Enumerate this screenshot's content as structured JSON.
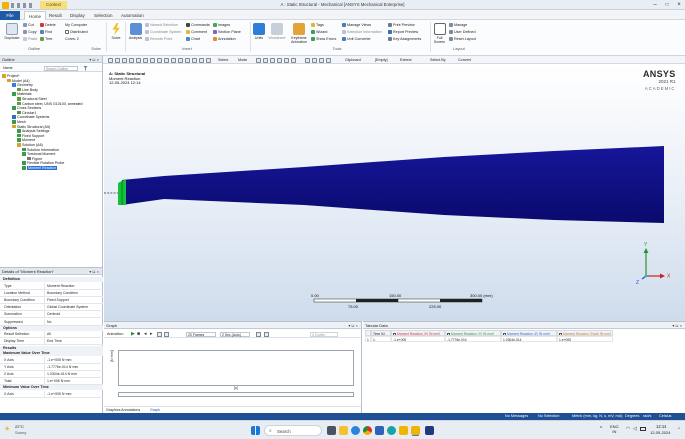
{
  "window": {
    "title": "A : Static Structural - Mechanical [ANSYS Mechanical Enterprise]",
    "context_tab": "Context"
  },
  "tabs": [
    "File",
    "Home",
    "Result",
    "Display",
    "Selection",
    "Automation"
  ],
  "search_placeholder": "Quick Search",
  "ribbon": {
    "outline": {
      "group": "Outline",
      "duplicate": "Duplicate",
      "cut": "Cut",
      "copy": "Copy",
      "paste": "Paste",
      "delete": "Delete",
      "find": "Find",
      "tree": "Tree",
      "my_computer": "My Computer",
      "distributed": "Distributed",
      "cores": "Cores: 2"
    },
    "solve": {
      "group": "Solve",
      "solve": "Solve"
    },
    "insert": {
      "group": "Insert",
      "analysis": "Analysis",
      "named_selection": "Named Selection",
      "coordinate_system": "Coordinate System",
      "remote_point": "Remote Point",
      "commands": "Commands",
      "comment": "Comment",
      "chart": "Chart",
      "images": "Images",
      "section_plane": "Section Plane",
      "annotation": "Annotation"
    },
    "tools": {
      "group": "Tools",
      "units": "Units",
      "worksheet": "Worksheet",
      "keyframe": "Keyframe Animation",
      "tags": "Tags",
      "wizard": "Wizard",
      "show_errors": "Show Errors",
      "manage_views": "Manage Views",
      "selection_info": "Selection Information",
      "unit_converter": "Unit Converter",
      "print_preview": "Print Preview",
      "report_preview": "Report Preview",
      "key_assignments": "Key Assignments"
    },
    "layout": {
      "group": "Layout",
      "full_screen": "Full Screen",
      "manage": "Manage",
      "user_defined": "User Defined",
      "reset_layout": "Reset Layout"
    }
  },
  "toolbar": {
    "select": "Select",
    "mode": "Mode",
    "clipboard": "Clipboard",
    "empty": "[Empty]",
    "extend": "Extend",
    "select_by": "Select By",
    "convert": "Convert"
  },
  "outline": {
    "title": "Outline",
    "name_label": "Name",
    "search_placeholder": "Search Outline",
    "items": [
      {
        "label": "Project*",
        "level": 0,
        "color": "#d9a12a"
      },
      {
        "label": "Model (A4)",
        "level": 1,
        "color": "#d9a12a"
      },
      {
        "label": "Geometry",
        "level": 2,
        "color": "#3a7bd5"
      },
      {
        "label": "Line Body",
        "level": 3,
        "color": "#5c9e3e"
      },
      {
        "label": "Materials",
        "level": 2,
        "color": "#3a9a4a"
      },
      {
        "label": "Structural Steel",
        "level": 3,
        "color": "#5c9e3e"
      },
      {
        "label": "Carbon steel, UNS G10100, annealed",
        "level": 3,
        "color": "#5c9e3e"
      },
      {
        "label": "Cross Sections",
        "level": 2,
        "color": "#3a9a4a"
      },
      {
        "label": "Circular1",
        "level": 3,
        "color": "#3a9a4a"
      },
      {
        "label": "Coordinate Systems",
        "level": 2,
        "color": "#2e6ebf"
      },
      {
        "label": "Mesh",
        "level": 2,
        "color": "#3a9a4a"
      },
      {
        "label": "Static Structural (A5)",
        "level": 2,
        "color": "#d9a12a"
      },
      {
        "label": "Analysis Settings",
        "level": 3,
        "color": "#3a9a4a"
      },
      {
        "label": "Fixed Support",
        "level": 3,
        "color": "#3a9a4a"
      },
      {
        "label": "Moment",
        "level": 3,
        "color": "#3a9a4a"
      },
      {
        "label": "Solution (A6)",
        "level": 3,
        "color": "#d9a12a"
      },
      {
        "label": "Solution Information",
        "level": 4,
        "color": "#3a9a4a"
      },
      {
        "label": "Torsional Moment",
        "level": 4,
        "color": "#3a9a4a"
      },
      {
        "label": "Figure",
        "level": 5,
        "color": "#777777"
      },
      {
        "label": "Flexible Rotation Probe",
        "level": 4,
        "color": "#3a9a4a"
      },
      {
        "label": "Moment Reaction",
        "level": 4,
        "color": "#3a9a4a",
        "selected": true
      }
    ]
  },
  "details": {
    "title": "Details of \"Moment Reaction\"",
    "sections": [
      {
        "name": "Definition",
        "rows": [
          [
            "Type",
            "Moment Reaction"
          ],
          [
            "Location Method",
            "Boundary Condition"
          ],
          [
            "Boundary Condition",
            "Fixed Support"
          ],
          [
            "Orientation",
            "Global Coordinate System"
          ],
          [
            "Summation",
            "Centroid"
          ],
          [
            "Suppressed",
            "No"
          ]
        ]
      },
      {
        "name": "Options",
        "rows": [
          [
            "Result Selection",
            "All"
          ],
          [
            "Display Time",
            "End Time"
          ]
        ]
      },
      {
        "name": "Results",
        "rows": []
      },
      {
        "name": "Maximum Value Over Time",
        "rows": [
          [
            "X Axis",
            "-1.e+005 N·mm"
          ],
          [
            "Y Axis",
            "-1.7776e-014 N·mm"
          ],
          [
            "Z Axis",
            "1.0304e-014 N·mm"
          ],
          [
            "Total",
            "1.e+005 N·mm"
          ]
        ]
      },
      {
        "name": "Minimum Value Over Time",
        "rows": [
          [
            "X Axis",
            "-1.e+005 N·mm"
          ]
        ]
      }
    ]
  },
  "viewport": {
    "title": "A: Static Structural",
    "subtitle": "Moment Reaction",
    "date": "12-05-2024 12:14",
    "logo": "ANSYS",
    "version": "2021 R1",
    "edition": "ACADEMIC",
    "scale": {
      "labels": [
        "0.00",
        "150.00",
        "300.00 (mm)"
      ],
      "sublabels": [
        "75.00",
        "225.00"
      ]
    },
    "triad": {
      "x": "X",
      "y": "Y",
      "z": "Z"
    },
    "colors": {
      "beam": "#16169a",
      "beam_dark": "#0a0a6e",
      "support": "#12c23a"
    }
  },
  "graph": {
    "title": "Graph",
    "animation": "Animation",
    "frames": "20 Frames",
    "sec": "2 Sec (Auto)",
    "cycles": "3 Cycles",
    "ylabel": "[N·mm]",
    "xlabel": "[s]",
    "bottom_tabs": [
      "Graphics Annotations",
      "Graph"
    ]
  },
  "tabular": {
    "title": "Tabular Data",
    "headers": [
      "",
      "Time [s]",
      "Moment Reaction (X) [N·mm]",
      "Moment Reaction (Y) [N·mm]",
      "Moment Reaction (Z) [N·mm]",
      "Moment Reaction (Total) [N·mm]"
    ],
    "rows": [
      [
        "1",
        "1.",
        "-1.e+005",
        "-1.7776e-014",
        "1.0304e-014",
        "1.e+005"
      ]
    ]
  },
  "status": {
    "messages": "No Messages",
    "selection": "No Selection",
    "units": "Metric (mm, kg, N, s, mV, mA)",
    "degrees": "Degrees",
    "rad": "rad/s",
    "celsius": "Celsius"
  },
  "taskbar": {
    "weather_temp": "22°C",
    "weather_desc": "Sunny",
    "search": "Search",
    "lang1": "ENG",
    "lang2": "IN",
    "time": "12:14",
    "date": "12-05-2024"
  }
}
